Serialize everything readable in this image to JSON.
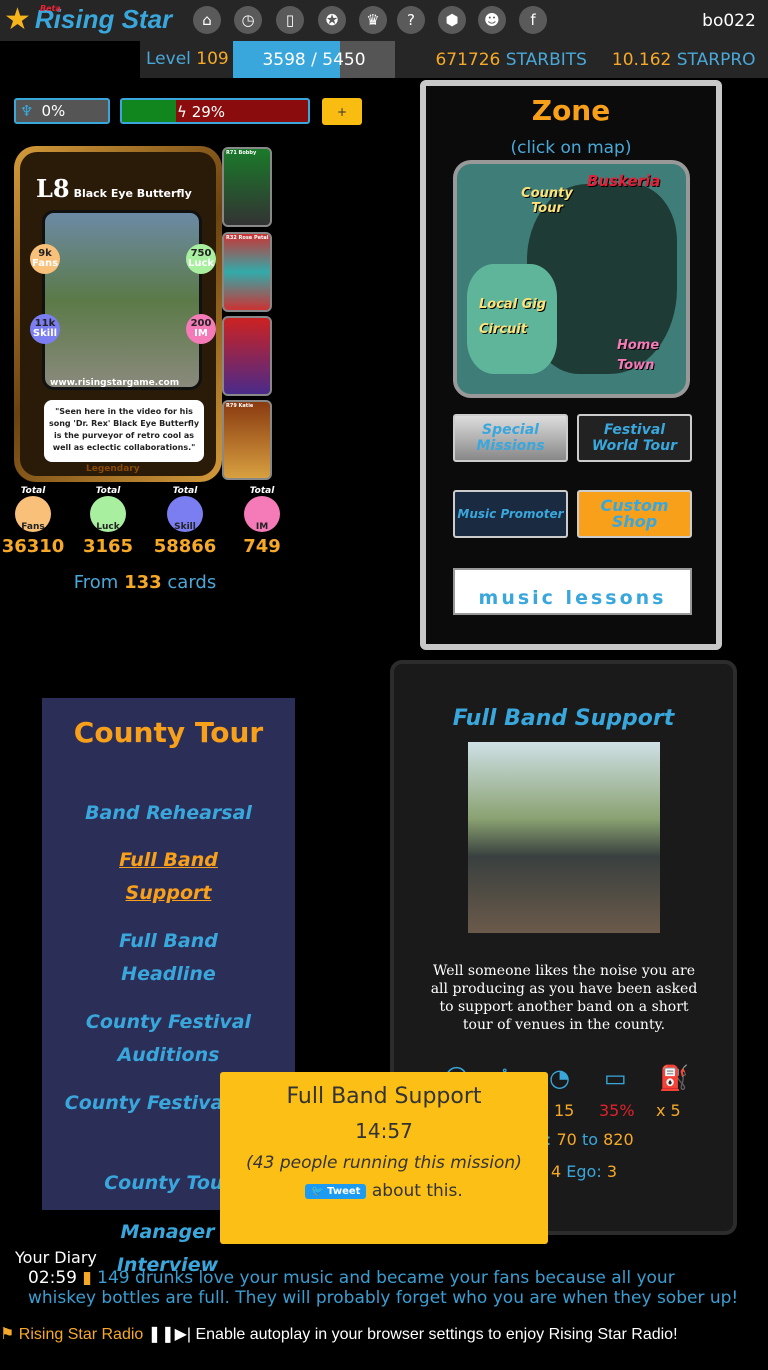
{
  "header": {
    "logo": "Rising Star",
    "beta": "Beta",
    "username": "bo022",
    "nav_icons": [
      "home-icon",
      "stopwatch-icon",
      "cards-icon",
      "award-ribbon-icon",
      "trophy-icon",
      "help-icon",
      "hive-icon",
      "discord-icon",
      "facebook-icon"
    ]
  },
  "level": {
    "label": "Level",
    "value": "109",
    "xp_text": "3598 / 5450",
    "xp_current": 3598,
    "xp_max": 5450
  },
  "currency": {
    "starbits_value": "671726",
    "starbits_label": "STARBITS",
    "starpro_value": "10.162",
    "starpro_label": "STARPRO"
  },
  "status": {
    "ego": "0%",
    "energy": "29%",
    "energy_percent": 29,
    "plus_label": "+"
  },
  "card": {
    "level": "L8",
    "name": "Black Eye Butterfly",
    "fans": "9k",
    "fans_label": "Fans",
    "luck": "750",
    "luck_label": "Luck",
    "skill": "11k",
    "skill_label": "Skill",
    "im": "200",
    "im_label": "IM",
    "url": "www.risingstargame.com",
    "quote": "\"Seen here in the video for his song 'Dr. Rex' Black Eye Butterfly is the purveyor of retro cool as well as eclectic collaborations.\"",
    "rarity": "Legendary"
  },
  "mini_cards": [
    {
      "label": "R71 Bobby"
    },
    {
      "label": "R32 Rose Petal"
    },
    {
      "label": ""
    },
    {
      "label": "R79 Katie"
    }
  ],
  "totals": {
    "header": "Total",
    "items": [
      {
        "label": "Fans",
        "value": "36310",
        "color": "#f9c07a"
      },
      {
        "label": "Luck",
        "value": "3165",
        "color": "#a8f0a0"
      },
      {
        "label": "Skill",
        "value": "58866",
        "color": "#7b7ef0"
      },
      {
        "label": "IM",
        "value": "749",
        "color": "#f47ab8"
      }
    ],
    "from_prefix": "From",
    "from_count": "133",
    "from_suffix": "cards"
  },
  "zone": {
    "title": "Zone",
    "subtitle": "(click on map)",
    "map_labels": {
      "county_tour": "County Tour",
      "buskeria": "Buskeria",
      "local_gig": "Local Gig Circuit",
      "home_town": "Home Town"
    },
    "buttons": {
      "special": "Special Missions",
      "festival": "Festival World Tour",
      "promoter": "Music Promoter",
      "shop": "Custom Shop",
      "lessons": "music lessons"
    }
  },
  "county": {
    "title": "County Tour",
    "items": [
      {
        "label": "Band Rehearsal",
        "active": false
      },
      {
        "label": "Full Band Support",
        "active": true
      },
      {
        "label": "Full Band Headline",
        "active": false
      },
      {
        "label": "County Festival Auditions",
        "active": false
      },
      {
        "label": "County Festival Gig",
        "active": false
      },
      {
        "label": "County Tour",
        "active": false
      },
      {
        "label": "Manager Interview",
        "active": false
      }
    ]
  },
  "mission": {
    "title": "Full Band Support",
    "description": "Well someone likes the noise you are all producing as you have been asked to support another band on a short tour of venues in the county.",
    "stats": {
      "time": "15",
      "energy": "35%",
      "fuel": "x 5",
      "range_sep": ":",
      "range_min": "70",
      "range_to": "to",
      "range_max": "820",
      "other_value": "4",
      "ego_label": "Ego:",
      "ego_value": "3"
    }
  },
  "tooltip": {
    "title": "Full Band Support",
    "timer": "14:57",
    "running": "(43 people running this mission)",
    "tweet": "Tweet",
    "about": "about this."
  },
  "diary": {
    "title": "Your Diary",
    "time": "02:59",
    "message": "149 drunks love your music and became your fans because all your whiskey bottles are full. They will probably forget who you are when they sober up!"
  },
  "radio": {
    "label": "Rising Star Radio",
    "message": "Enable autoplay in your browser settings to enjoy Rising Star Radio!"
  }
}
